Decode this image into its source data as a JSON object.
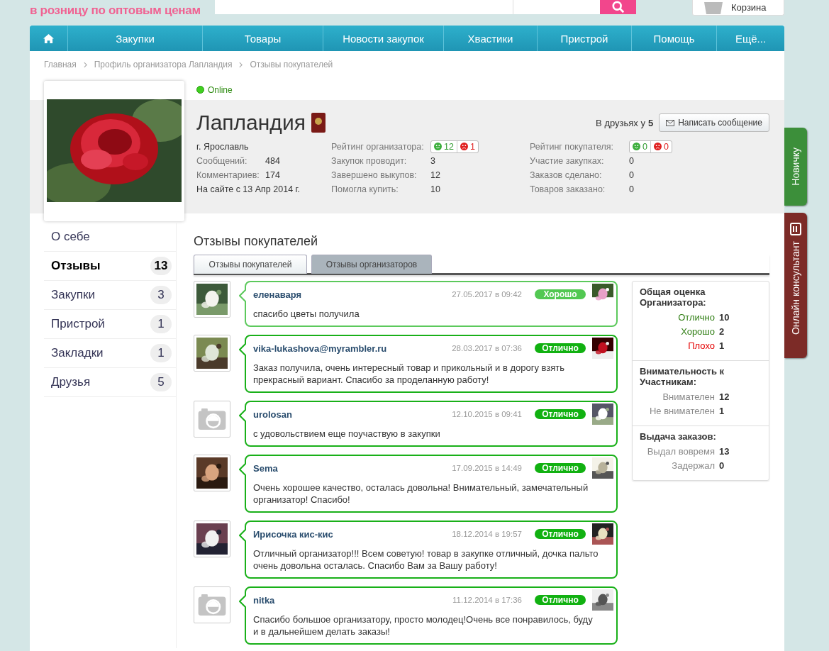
{
  "header": {
    "tagline": "в розницу по оптовым ценам",
    "cart_label": "Корзина"
  },
  "nav": {
    "items": [
      "Закупки",
      "Товары",
      "Новости закупок",
      "Хвастики",
      "Пристрой",
      "Помощь",
      "Ещё..."
    ]
  },
  "breadcrumbs": [
    "Главная",
    "Профиль организатора Лапландия",
    "Отзывы покупателей"
  ],
  "profile": {
    "status": "Online",
    "online": true,
    "name": "Лапландия",
    "friends_label": "В друзьях у",
    "friends_count": "5",
    "message_button": "Написать сообщение",
    "city": "г. Ярославль",
    "stats": [
      {
        "label": "Сообщений:",
        "value": "484"
      },
      {
        "label": "Комментариев:",
        "value": "174"
      }
    ],
    "since": "На сайте с 13 Апр 2014 г.",
    "organizer_rating": {
      "label": "Рейтинг организатора:",
      "positive": "12",
      "negative": "1"
    },
    "organizer_stats": [
      {
        "label": "Закупок проводит:",
        "value": "3"
      },
      {
        "label": "Завершено выкупов:",
        "value": "12"
      },
      {
        "label": "Помогла купить:",
        "value": "10"
      }
    ],
    "buyer_rating": {
      "label": "Рейтинг покупателя:",
      "positive": "0",
      "negative": "0"
    },
    "buyer_stats": [
      {
        "label": "Участие закупках:",
        "value": "0"
      },
      {
        "label": "Заказов сделано:",
        "value": "0"
      },
      {
        "label": "Товаров заказано:",
        "value": "0"
      }
    ]
  },
  "sidebar": {
    "items": [
      {
        "label": "О себе",
        "selected": false
      },
      {
        "label": "Отзывы",
        "count": "13",
        "selected": true
      },
      {
        "label": "Закупки",
        "count": "3",
        "selected": false
      },
      {
        "label": "Пристрой",
        "count": "1",
        "selected": false
      },
      {
        "label": "Закладки",
        "count": "1",
        "selected": false
      },
      {
        "label": "Друзья",
        "count": "5",
        "selected": false
      }
    ]
  },
  "section_title": "Отзывы покупателей",
  "tabs": [
    {
      "label": "Отзывы покупателей",
      "selected": true
    },
    {
      "label": "Отзывы организаторов",
      "selected": false
    }
  ],
  "reviews": [
    {
      "author": "еленаваря",
      "date": "27.05.2017 в 09:42",
      "rating": "Хорошо",
      "kind": "good",
      "text": "спасибо цветы получила"
    },
    {
      "author": "vika-lukashova@myrambler.ru",
      "date": "28.03.2017 в 07:36",
      "rating": "Отлично",
      "kind": "excellent",
      "text": "Заказ получила, очень интересный товар и прикольный и в дорогу взять прекрасный вариант. Спасибо за проделанную работу!"
    },
    {
      "author": "urolosan",
      "date": "12.10.2015 в 09:41",
      "rating": "Отлично",
      "kind": "excellent",
      "avatar": {
        "kind": "placeholder"
      },
      "text": "с удовольствием еще поучаствую в закупки"
    },
    {
      "author": "Sema",
      "date": "17.09.2015 в 14:49",
      "rating": "Отлично",
      "kind": "excellent",
      "text": "Очень хорошее качество, осталась довольна! Внимательный, замечательный организатор! Спасибо!"
    },
    {
      "author": "Ирисочка кис-кис",
      "date": "18.12.2014 в 19:57",
      "rating": "Отлично",
      "kind": "excellent",
      "text": "Отличный организатор!!! Всем советую! товар в закупке отличный, дочка пальто очень довольна осталась. Спасибо Вам за Вашу работу!"
    },
    {
      "author": "nitka",
      "date": "11.12.2014 в 17:36",
      "rating": "Отлично",
      "kind": "excellent",
      "avatar": {
        "kind": "placeholder"
      },
      "text": "Спасибо большое организатору, просто молодец!Очень все понравилось, буду и в дальнейшем делать заказы!"
    }
  ],
  "summary": {
    "sections": [
      {
        "title": "Общая оценка Организатора:",
        "rows": [
          {
            "label": "Отлично",
            "value": "10",
            "kind": "excellent"
          },
          {
            "label": "Хорошо",
            "value": "2",
            "kind": "good"
          },
          {
            "label": "Плохо",
            "value": "1",
            "kind": "bad"
          }
        ]
      },
      {
        "title": "Внимательность к Участникам:",
        "rows": [
          {
            "label": "Внимателен",
            "value": "12",
            "kind": "neutral"
          },
          {
            "label": "Не внимателен",
            "value": "1",
            "kind": "neutral"
          }
        ]
      },
      {
        "title": "Выдача заказов:",
        "rows": [
          {
            "label": "Выдал вовремя",
            "value": "13",
            "kind": "neutral"
          },
          {
            "label": "Задержал",
            "value": "0",
            "kind": "neutral"
          }
        ]
      }
    ]
  },
  "side_tabs": [
    {
      "label": "Новичку",
      "kind": "newbie"
    },
    {
      "label": "Онлайн консультант",
      "kind": "consultant"
    }
  ]
}
